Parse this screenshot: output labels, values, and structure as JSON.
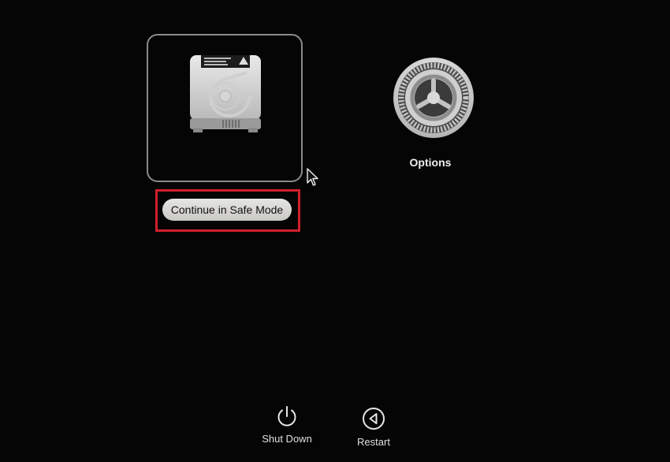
{
  "startup_disk": {
    "icon": "hard-drive-icon",
    "action_label": "Continue in Safe Mode"
  },
  "options": {
    "icon": "gear-icon",
    "label": "Options"
  },
  "bottom_bar": {
    "shutdown": {
      "icon": "power-icon",
      "label": "Shut Down"
    },
    "restart": {
      "icon": "restart-icon",
      "label": "Restart"
    }
  },
  "colors": {
    "background": "#050505",
    "highlight": "#d0202a",
    "tile_border": "#8a8a8a"
  }
}
